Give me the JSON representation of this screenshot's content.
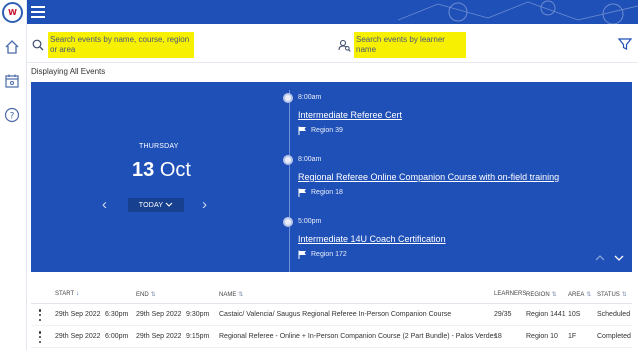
{
  "colors": {
    "brand_blue": "#1f50b8",
    "highlight": "#f7f000",
    "panel_dark": "#17408f"
  },
  "rail": {
    "logo_text": "W",
    "icons": [
      "home-icon",
      "calendar-icon",
      "help-icon"
    ]
  },
  "header": {
    "menu_icon": "hamburger-icon"
  },
  "search": {
    "event_placeholder": "Search events by name, course, region or area",
    "learner_placeholder": "Search events by learner name",
    "filter_icon": "filter-icon"
  },
  "display_label": "Displaying All Events",
  "calendar": {
    "day_name": "THURSDAY",
    "day_number": "13",
    "month": "Oct",
    "today_label": "TODAY",
    "events": [
      {
        "time": "8:00am",
        "title": "Intermediate Referee Cert",
        "region": "Region 39"
      },
      {
        "time": "8:00am",
        "title": "Regional Referee Online Companion Course with on-field training",
        "region": "Region 18"
      },
      {
        "time": "5:00pm",
        "title": "Intermediate 14U Coach Certification",
        "region": "Region 172"
      }
    ]
  },
  "table": {
    "columns": {
      "start": "START",
      "end": "END",
      "name": "NAME",
      "learners": "LEARNERS",
      "region": "REGION",
      "area": "AREA",
      "status": "STATUS"
    },
    "rows": [
      {
        "start_date": "29th Sep 2022",
        "start_time": "6:30pm",
        "end_date": "29th Sep 2022",
        "end_time": "9:30pm",
        "name": "Castaic/ Valencia/ Saugus Regional Referee In-Person Companion Course",
        "learners": "29/35",
        "region": "Region 1441",
        "area": "10S",
        "status": "Scheduled"
      },
      {
        "start_date": "29th Sep 2022",
        "start_time": "6:00pm",
        "end_date": "29th Sep 2022",
        "end_time": "9:15pm",
        "name": "Regional Referee - Online + In-Person Companion Course (2 Part Bundle) - Palos Verdes",
        "learners": "18",
        "region": "Region 10",
        "area": "1F",
        "status": "Completed"
      }
    ]
  }
}
